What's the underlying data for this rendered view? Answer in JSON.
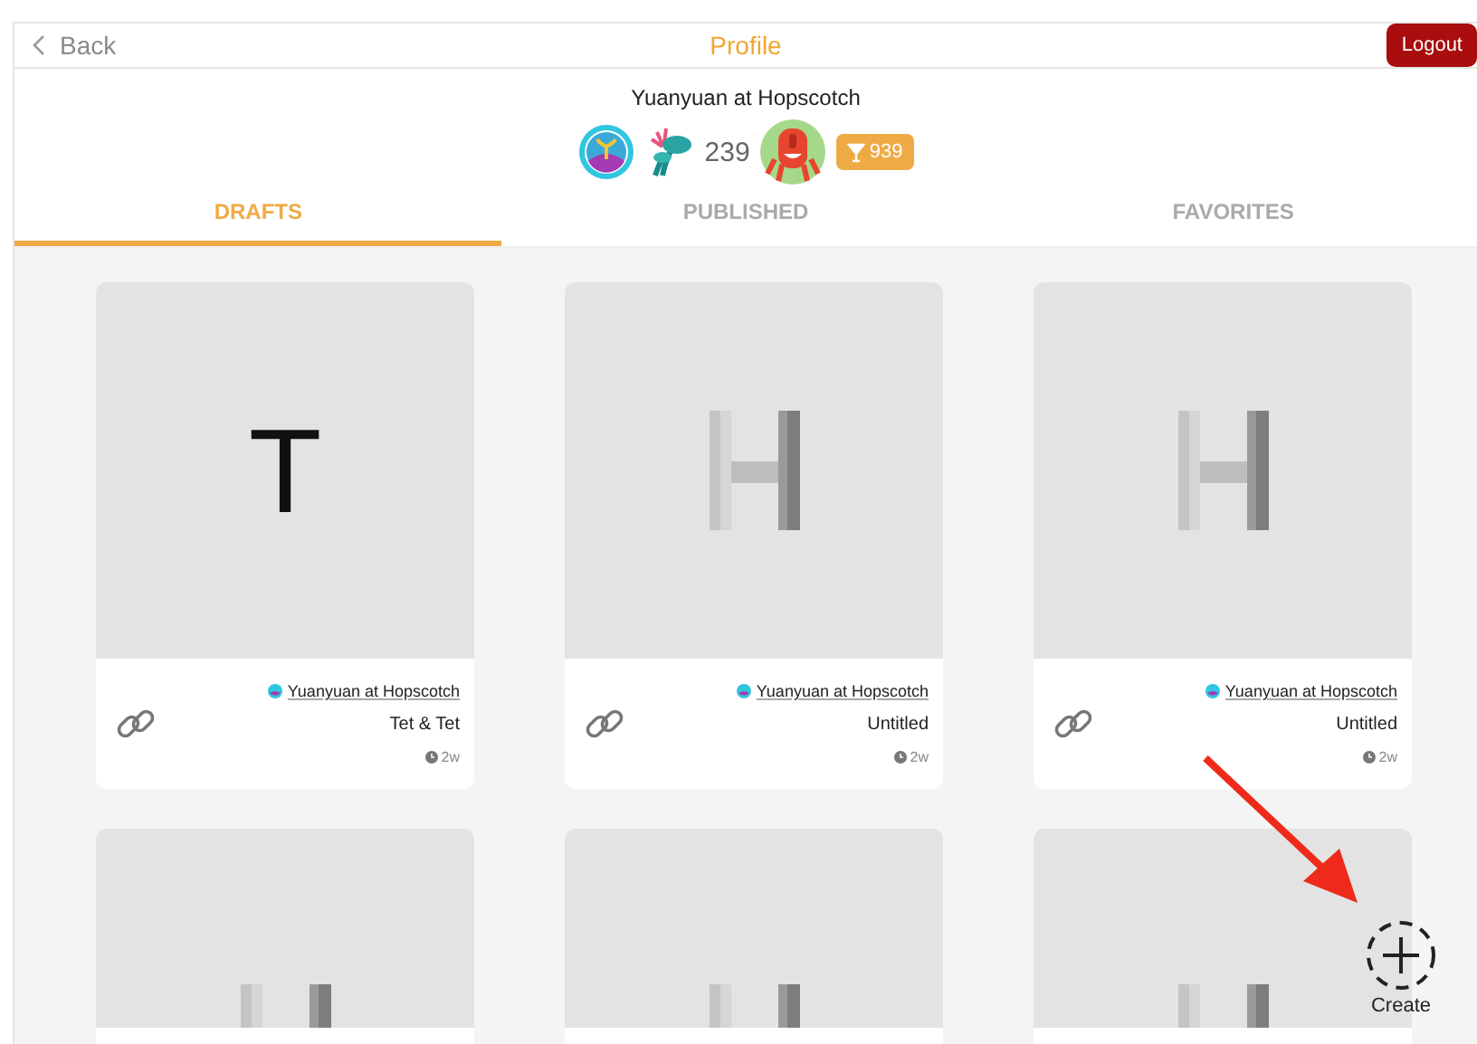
{
  "header": {
    "back": "Back",
    "title": "Profile",
    "logout": "Logout"
  },
  "profile": {
    "name": "Yuanyuan at Hopscotch",
    "followers": "239",
    "score": "939"
  },
  "tabs": [
    {
      "label": "DRAFTS",
      "selected": true
    },
    {
      "label": "PUBLISHED",
      "selected": false
    },
    {
      "label": "FAVORITES",
      "selected": false
    }
  ],
  "projects": [
    {
      "kind": "text",
      "thumb_text": "T",
      "author": "Yuanyuan at Hopscotch",
      "title": "Tet & Tet",
      "age": "2w"
    },
    {
      "kind": "logo",
      "author": "Yuanyuan at Hopscotch",
      "title": "Untitled",
      "age": "2w"
    },
    {
      "kind": "logo",
      "author": "Yuanyuan at Hopscotch",
      "title": "Untitled",
      "age": "2w"
    },
    {
      "kind": "logo"
    },
    {
      "kind": "logo"
    },
    {
      "kind": "logo"
    }
  ],
  "create": {
    "label": "Create"
  }
}
